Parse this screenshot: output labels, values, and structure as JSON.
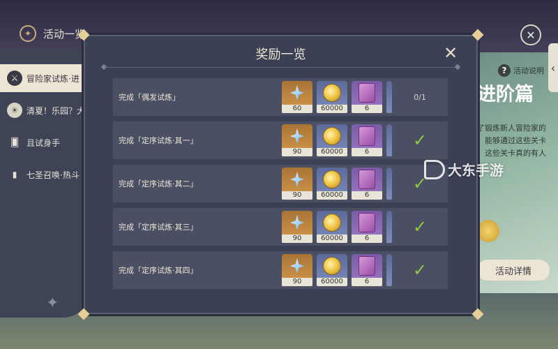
{
  "header": {
    "title": "活动一览"
  },
  "sidebar": {
    "items": [
      {
        "label": "冒险家试炼·进",
        "active": true
      },
      {
        "label": "清夏！乐园？大",
        "active": false
      },
      {
        "label": "且试身手",
        "active": false
      },
      {
        "label": "七圣召唤·热斗",
        "active": false
      }
    ]
  },
  "right_panel": {
    "help_label": "活动说明",
    "title": "进阶篇",
    "desc_lines": [
      "了锻炼新人冒险家的",
      "，能够通过这些关卡",
      "，这些关卡真的有人"
    ],
    "detail_button": "活动详情"
  },
  "watermark": {
    "text": "大东手游"
  },
  "modal": {
    "title": "奖励一览",
    "rows": [
      {
        "label": "完成「偶发试炼」",
        "gem": "60",
        "mora": "60000",
        "book": "6",
        "status": "0/1",
        "done": false
      },
      {
        "label": "完成「定序试炼·其一」",
        "gem": "90",
        "mora": "60000",
        "book": "6",
        "status": "",
        "done": true
      },
      {
        "label": "完成「定序试炼·其二」",
        "gem": "90",
        "mora": "60000",
        "book": "6",
        "status": "",
        "done": true
      },
      {
        "label": "完成「定序试炼·其三」",
        "gem": "90",
        "mora": "60000",
        "book": "6",
        "status": "",
        "done": true
      },
      {
        "label": "完成「定序试炼·其四」",
        "gem": "90",
        "mora": "60000",
        "book": "6",
        "status": "",
        "done": true
      }
    ]
  },
  "colors": {
    "accent_gold": "#e6cf96",
    "check_green": "#8ecb3e",
    "modal_bg": "#3b4054"
  },
  "icons": {
    "gem": "primogem-icon",
    "mora": "mora-coin-icon",
    "book": "heros-wit-book-icon",
    "check": "check-icon",
    "close": "close-icon"
  }
}
